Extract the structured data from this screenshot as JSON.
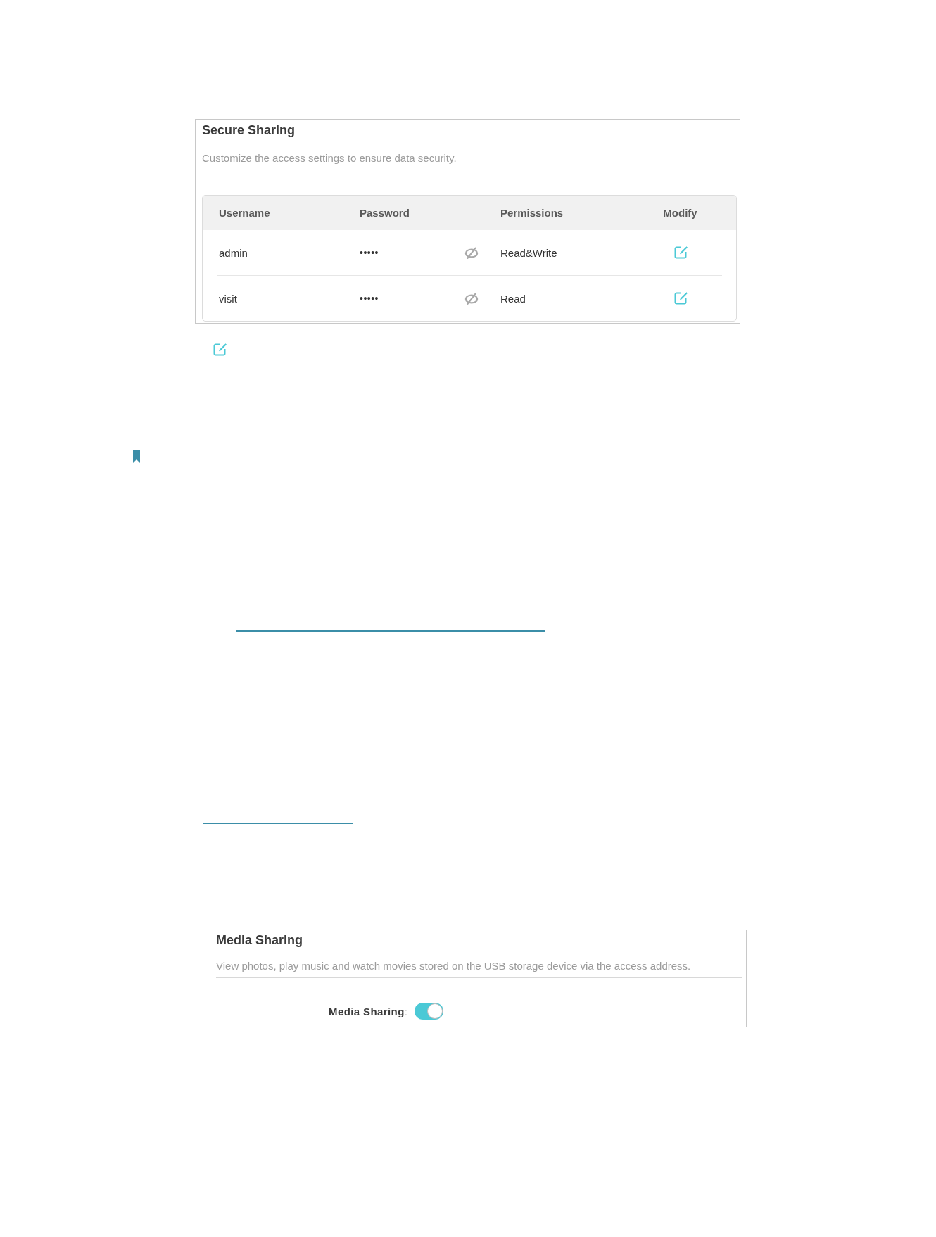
{
  "secure_sharing": {
    "title": "Secure Sharing",
    "description": "Customize the access settings to ensure data security.",
    "table": {
      "columns": [
        "Username",
        "Password",
        "Permissions",
        "Modify"
      ],
      "rows": [
        {
          "username": "admin",
          "password": "•••••",
          "permissions": "Read&Write"
        },
        {
          "username": "visit",
          "password": "•••••",
          "permissions": "Read"
        }
      ]
    }
  },
  "media_sharing": {
    "title": "Media Sharing",
    "description": "View photos, play music and watch movies stored on the USB storage device via the access address.",
    "toggle": {
      "label": "**Media Sharing**:",
      "on": true
    }
  }
}
